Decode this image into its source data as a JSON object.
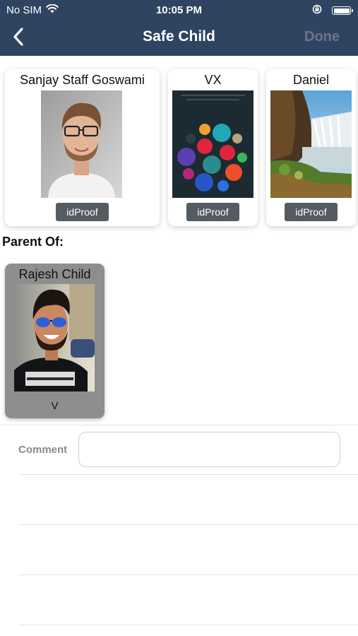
{
  "status_bar": {
    "carrier": "No SIM",
    "time": "10:05 PM",
    "icons": [
      "wifi-icon",
      "orientation-lock-icon",
      "battery-icon"
    ]
  },
  "navbar": {
    "title": "Safe Child",
    "done_label": "Done",
    "back_icon": "chevron-left-icon",
    "background": "#2f4461",
    "done_color": "#6b7688"
  },
  "staff_cards": [
    {
      "name": "Sanjay Staff Goswami",
      "button_label": "idProof",
      "photo": "man-portrait-glasses"
    },
    {
      "name": "VX",
      "button_label": "idProof",
      "photo": "colorful-dots-poster"
    },
    {
      "name": "Daniel",
      "button_label": "idProof",
      "photo": "waterfall-landscape"
    }
  ],
  "section_title": "Parent Of:",
  "child_card": {
    "name": "Rajesh Child",
    "label": "V",
    "photo": "man-portrait-sunglasses",
    "background": "#8e8e8e"
  },
  "comment": {
    "label": "Comment",
    "value": "",
    "placeholder": ""
  }
}
